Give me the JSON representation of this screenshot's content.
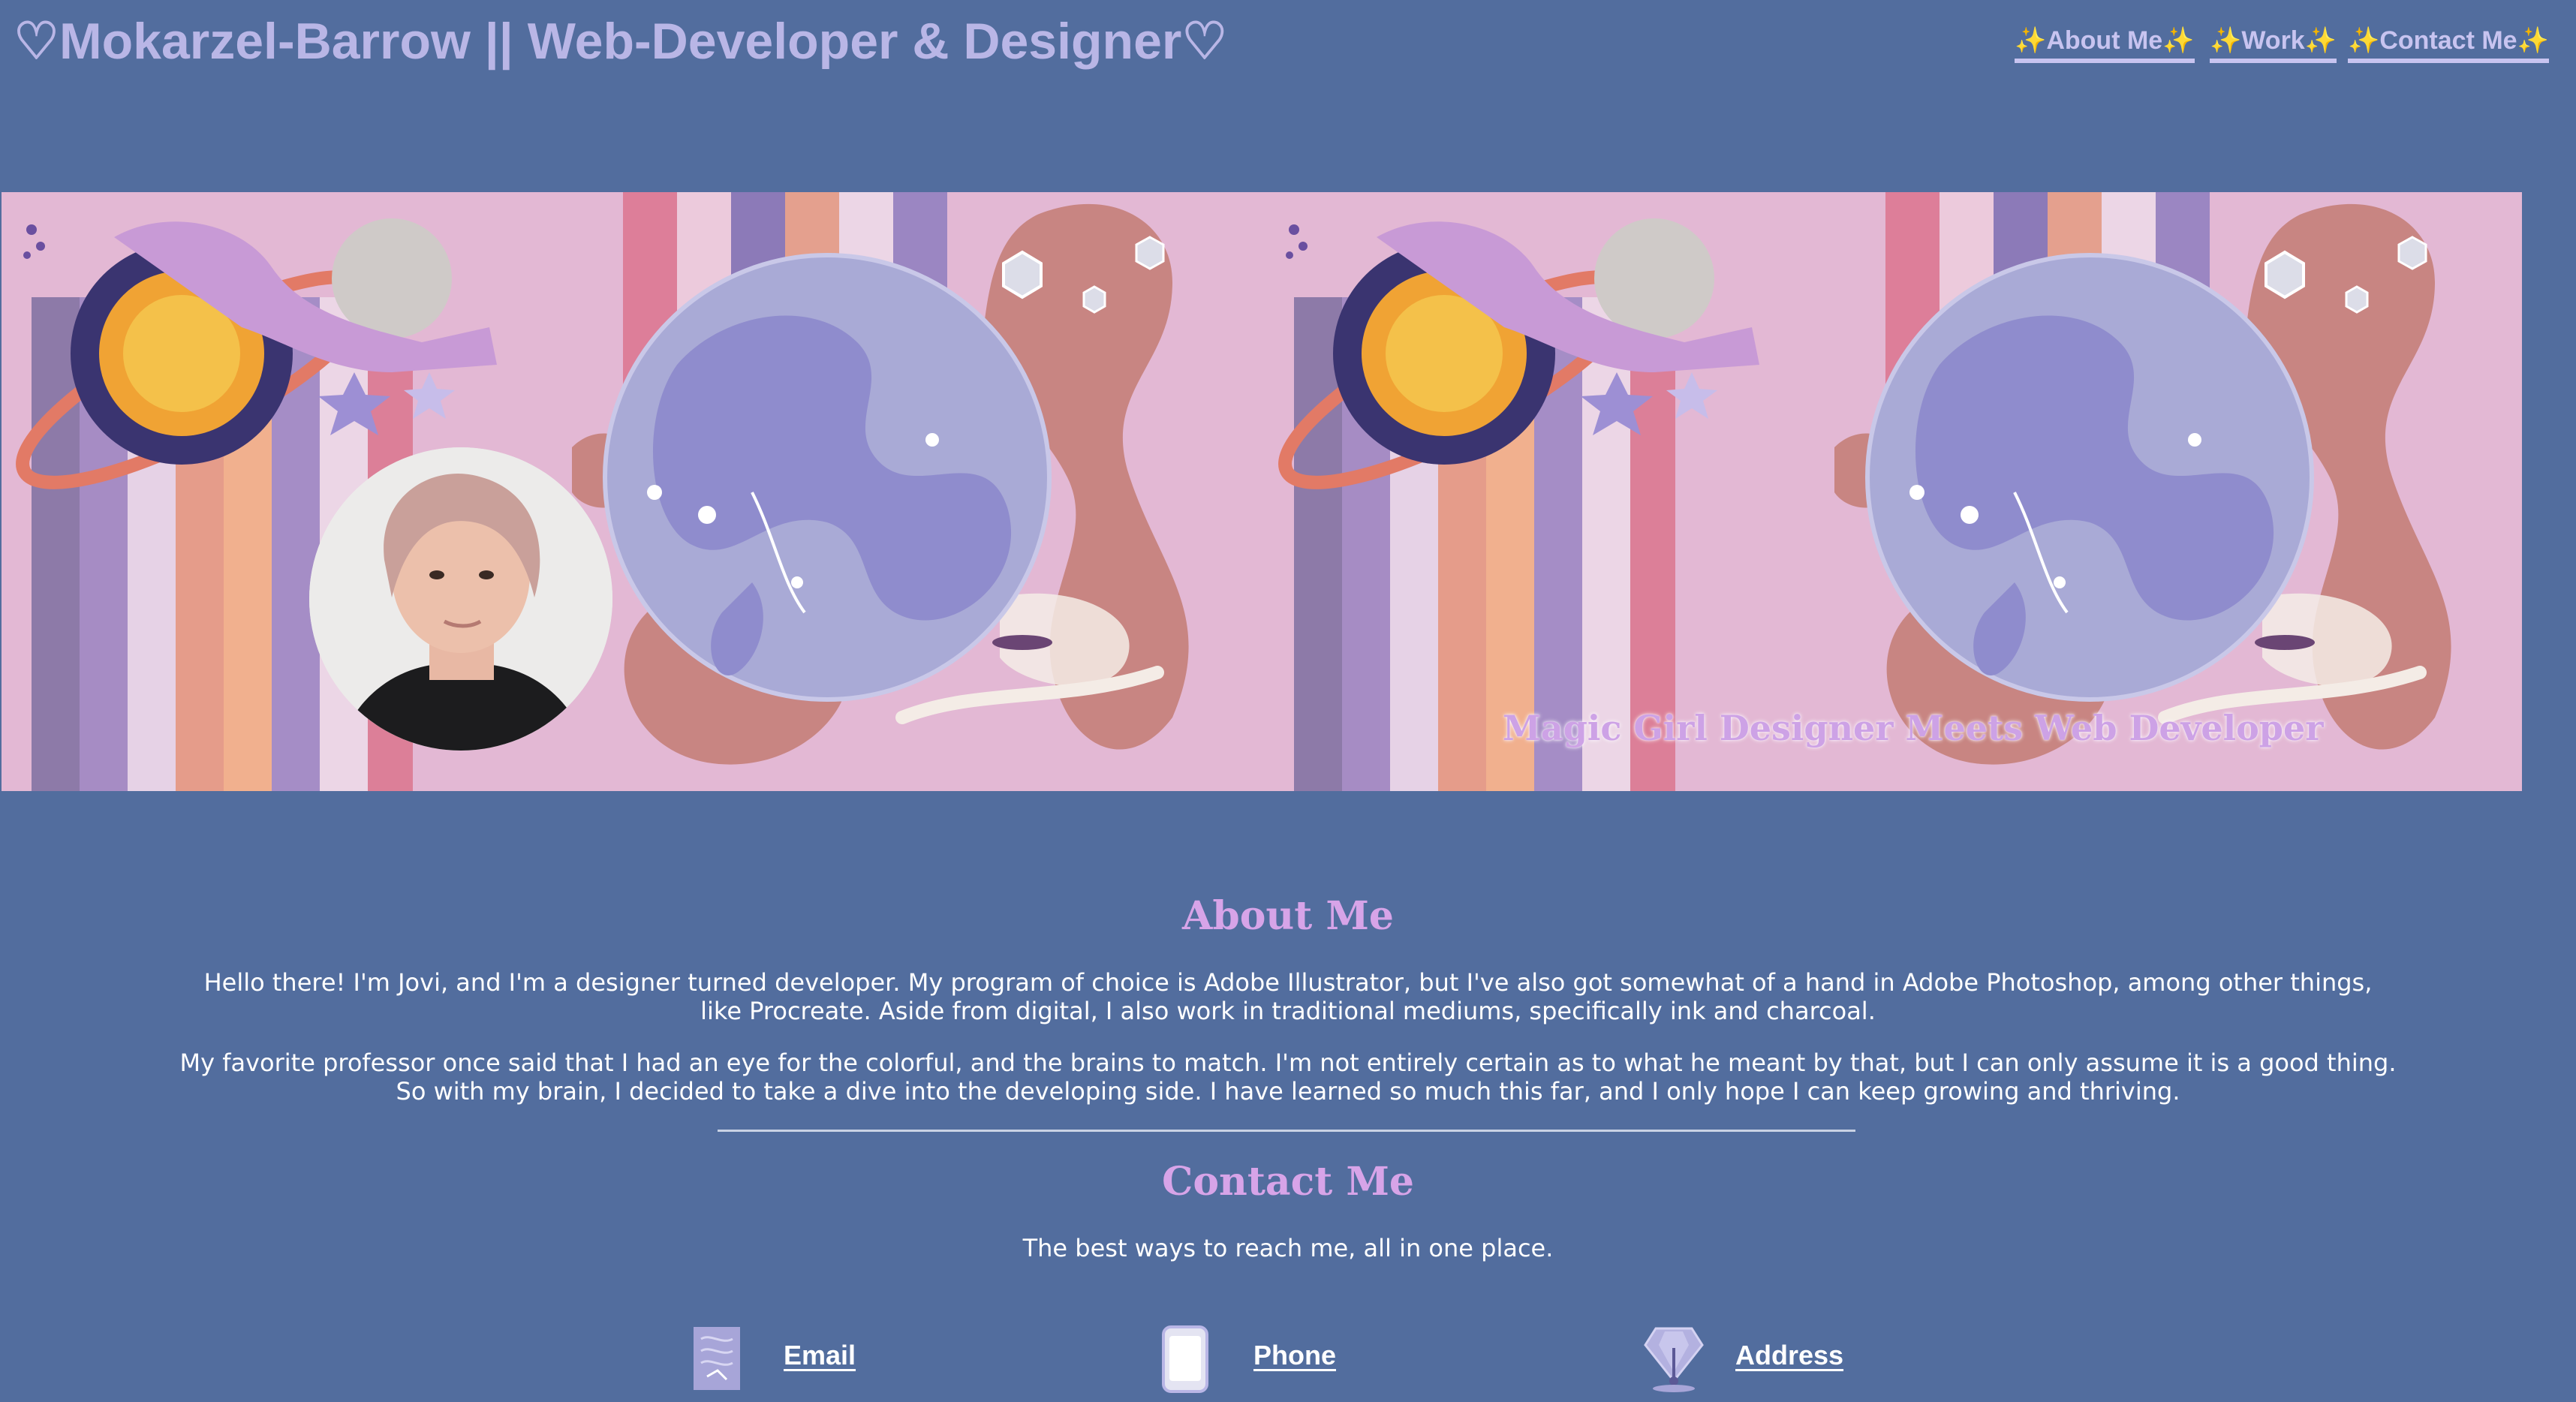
{
  "header": {
    "site_title": "♡Mokarzel-Barrow || Web-Developer & Designer♡"
  },
  "nav": {
    "items": [
      {
        "label": "✨About Me✨"
      },
      {
        "label": "✨Work✨"
      },
      {
        "label": "✨Contact Me✨"
      }
    ]
  },
  "banner": {
    "tagline": "Magic Girl Designer Meets Web Developer",
    "alt_avatar": "Portrait photo of Jovi"
  },
  "about": {
    "heading": "About Me",
    "paragraph_1": "Hello there! I'm Jovi, and I'm a designer turned developer. My program of choice is Adobe Illustrator, but I've also got somewhat of a hand in Adobe Photoshop, among other things, like Procreate. Aside from digital, I also work in traditional mediums, specifically ink and charcoal.",
    "paragraph_2": "My favorite professor once said that I had an eye for the colorful, and the brains to match. I'm not entirely certain as to what he meant by that, but I can only assume it is a good thing. So with my brain, I decided to take a dive into the developing side. I have learned so much this far, and I only hope I can keep growing and thriving."
  },
  "contact": {
    "heading": "Contact Me",
    "subtitle": "The best ways to reach me, all in one place.",
    "items": [
      {
        "label": "Email",
        "icon": "envelope-icon"
      },
      {
        "label": "Phone",
        "icon": "phone-icon"
      },
      {
        "label": "Address",
        "icon": "location-pin-icon"
      }
    ]
  },
  "colors": {
    "page_background": "#526d9e",
    "title": "#b9b6e6",
    "heading_accent": "#d7a4e8",
    "banner_pink": "#e3b8d4"
  }
}
